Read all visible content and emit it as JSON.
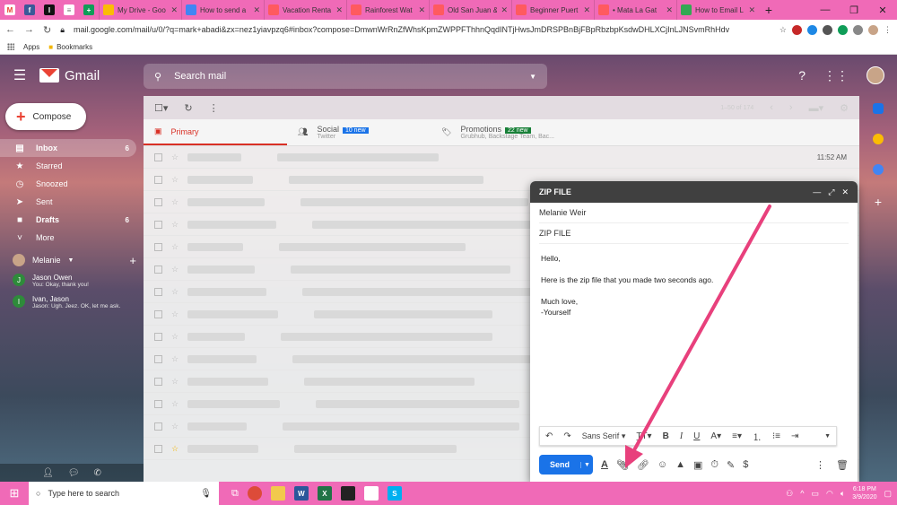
{
  "browser": {
    "tabs": [
      {
        "label": "My Drive - Goo",
        "color": "#fbbc04"
      },
      {
        "label": "How to send a",
        "color": "#4285f4"
      },
      {
        "label": "Vacation Renta",
        "color": "#ff5a5f"
      },
      {
        "label": "Rainforest Wat",
        "color": "#ff5a5f"
      },
      {
        "label": "Old San Juan &",
        "color": "#ff5a5f"
      },
      {
        "label": "Beginner Puert",
        "color": "#ff5a5f"
      },
      {
        "label": "• Mata La Gat",
        "color": "#ff5a5f"
      },
      {
        "label": "How to Email L",
        "color": "#34a853"
      }
    ],
    "url": "mail.google.com/mail/u/0/?q=mark+abadi&zx=nez1yiavpzq6#inbox?compose=DmwnWrRnZfWhsKpmZWPPFThhnQqdINTjHwsJmDRSPBnBjFBpRbzbpKsdwDHLXCjInLJNSvmRhHdv",
    "bookmarks": [
      "Apps",
      "Bookmarks"
    ]
  },
  "gmail": {
    "app_name": "Gmail",
    "search_placeholder": "Search mail",
    "compose_label": "Compose",
    "nav": [
      {
        "label": "Inbox",
        "count": "6",
        "icon": "▤"
      },
      {
        "label": "Starred",
        "count": "",
        "icon": "★"
      },
      {
        "label": "Snoozed",
        "count": "",
        "icon": "◷"
      },
      {
        "label": "Sent",
        "count": "",
        "icon": "➤"
      },
      {
        "label": "Drafts",
        "count": "6",
        "icon": "■"
      },
      {
        "label": "More",
        "count": "",
        "icon": "˅"
      }
    ],
    "hangouts_user": "Melanie",
    "chats": [
      {
        "name": "Jason Owen",
        "msg": "You: Okay, thank you!",
        "initial": "J"
      },
      {
        "name": "Ivan, Jason",
        "msg": "Jason: Ugh. Jeez. OK, let me ask.",
        "initial": "I"
      }
    ],
    "pager": "1–50 of 174",
    "category_tabs": [
      {
        "label": "Primary",
        "sub": "",
        "badge": ""
      },
      {
        "label": "Social",
        "sub": "Twitter",
        "badge": "10 new",
        "badge_color": "#1a73e8"
      },
      {
        "label": "Promotions",
        "sub": "Grubhub, Backstage Team, Bac...",
        "badge": "22 new",
        "badge_color": "#188038"
      }
    ],
    "first_row_time": "11:52 AM"
  },
  "compose": {
    "title": "ZIP FILE",
    "to": "Melanie Weir",
    "subject": "ZIP FILE",
    "body": [
      "Hello,",
      "Here is the zip file that you made two seconds ago.",
      "Much love,",
      "-Yourself"
    ],
    "font": "Sans Serif",
    "send_label": "Send"
  },
  "taskbar": {
    "search_placeholder": "Type here to search",
    "time": "6:18 PM",
    "date": "3/9/2020"
  },
  "annotation": {
    "arrow_color": "#e8407c"
  }
}
